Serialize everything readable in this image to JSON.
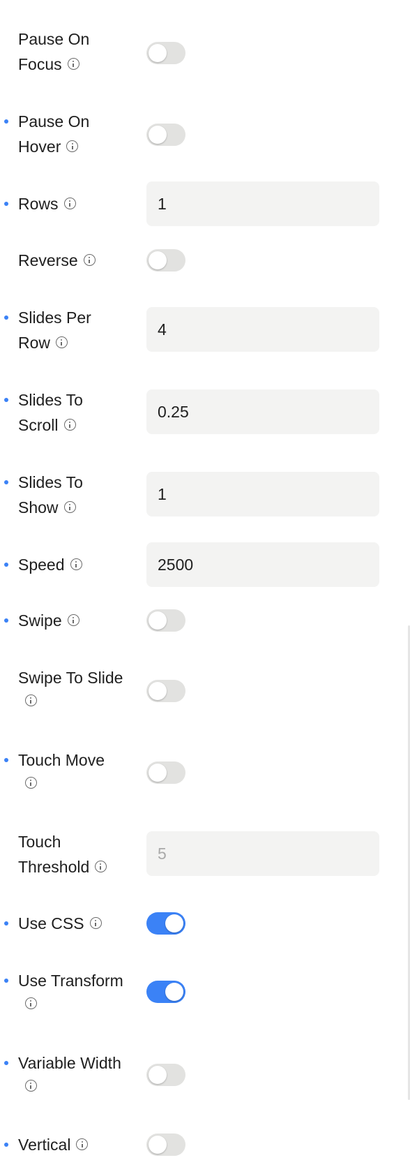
{
  "settings": {
    "pause_on_focus": {
      "label_line1": "Pause On",
      "label_line2": "Focus",
      "enabled": false,
      "modified": false
    },
    "pause_on_hover": {
      "label_line1": "Pause On",
      "label_line2": "Hover",
      "enabled": false,
      "modified": true
    },
    "rows": {
      "label": "Rows",
      "value": "1",
      "modified": true
    },
    "reverse": {
      "label": "Reverse",
      "enabled": false,
      "modified": false
    },
    "slides_per_row": {
      "label_line1": "Slides Per",
      "label_line2": "Row",
      "value": "4",
      "modified": true
    },
    "slides_to_scroll": {
      "label_line1": "Slides To",
      "label_line2": "Scroll",
      "value": "0.25",
      "modified": true
    },
    "slides_to_show": {
      "label_line1": "Slides To",
      "label_line2": "Show",
      "value": "1",
      "modified": true
    },
    "speed": {
      "label": "Speed",
      "value": "2500",
      "modified": true
    },
    "swipe": {
      "label": "Swipe",
      "enabled": false,
      "modified": true
    },
    "swipe_to_slide": {
      "label": "Swipe To Slide",
      "enabled": false,
      "modified": false
    },
    "touch_move": {
      "label": "Touch Move",
      "enabled": false,
      "modified": true
    },
    "touch_threshold": {
      "label_line1": "Touch",
      "label_line2": "Threshold",
      "placeholder": "5",
      "modified": false
    },
    "use_css": {
      "label": "Use CSS",
      "enabled": true,
      "modified": true
    },
    "use_transform": {
      "label": "Use Transform",
      "enabled": true,
      "modified": true
    },
    "variable_width": {
      "label": "Variable Width",
      "enabled": false,
      "modified": true
    },
    "vertical": {
      "label": "Vertical",
      "enabled": false,
      "modified": true
    }
  },
  "colors": {
    "accent": "#3b82f6",
    "toggle_off": "#e2e2e0",
    "input_bg": "#f3f3f2"
  },
  "icons": {
    "info": "info-circle-icon",
    "modified_marker": "dot"
  }
}
